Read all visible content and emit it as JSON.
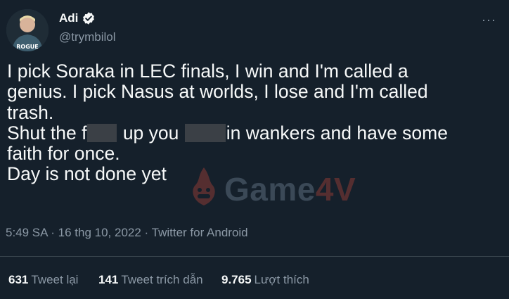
{
  "author": {
    "display_name": "Adi",
    "handle": "@trymbilol",
    "avatar_jersey_text": "ROGUE",
    "verified_icon": "verified-badge-icon"
  },
  "menu_icon": "more-options-icon",
  "tweet": {
    "lines": [
      "I pick Soraka in LEC finals, I win and I'm called a",
      "genius. I pick Nasus at worlds, I lose and I'm called",
      "trash.",
      "Shut the f",
      " up you ",
      "in wankers and have some",
      "faith for once.",
      "Day is not done yet"
    ]
  },
  "watermark": {
    "text_main": "Game",
    "text_accent": "4V",
    "logo_icon": "game4v-logo-icon"
  },
  "meta": {
    "timestamp": "5:49 SA · 16 thg 10, 2022 · Twitter for Android"
  },
  "stats": {
    "retweets_count": "631",
    "retweets_label": "Tweet lại",
    "quotes_count": "141",
    "quotes_label": "Tweet trích dẫn",
    "likes_count": "9.765",
    "likes_label": "Lượt thích"
  },
  "colors": {
    "background": "#15202b",
    "text_primary": "#f7f9f9",
    "text_secondary": "#8b98a5",
    "divider": "#38444d",
    "censor": "#3b4046"
  }
}
